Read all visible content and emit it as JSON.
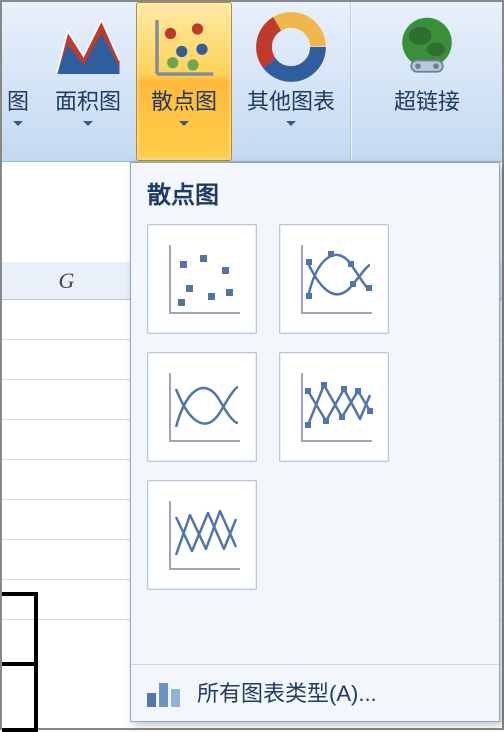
{
  "ribbon": {
    "items": [
      {
        "label": "图",
        "name": "chart-partial-button",
        "active": false
      },
      {
        "label": "面积图",
        "name": "area-chart-button",
        "active": false
      },
      {
        "label": "散点图",
        "name": "scatter-chart-button",
        "active": true
      },
      {
        "label": "其他图表",
        "name": "other-charts-button",
        "active": false
      },
      {
        "label": "超链接",
        "name": "hyperlink-button",
        "active": false
      }
    ]
  },
  "sheet": {
    "columns": [
      "G"
    ]
  },
  "dropdown": {
    "title": "散点图",
    "items": [
      {
        "name": "scatter-markers-only"
      },
      {
        "name": "scatter-smooth-lines-markers"
      },
      {
        "name": "scatter-smooth-lines"
      },
      {
        "name": "scatter-straight-lines-markers"
      },
      {
        "name": "scatter-straight-lines"
      }
    ],
    "footer": "所有图表类型(A)..."
  }
}
